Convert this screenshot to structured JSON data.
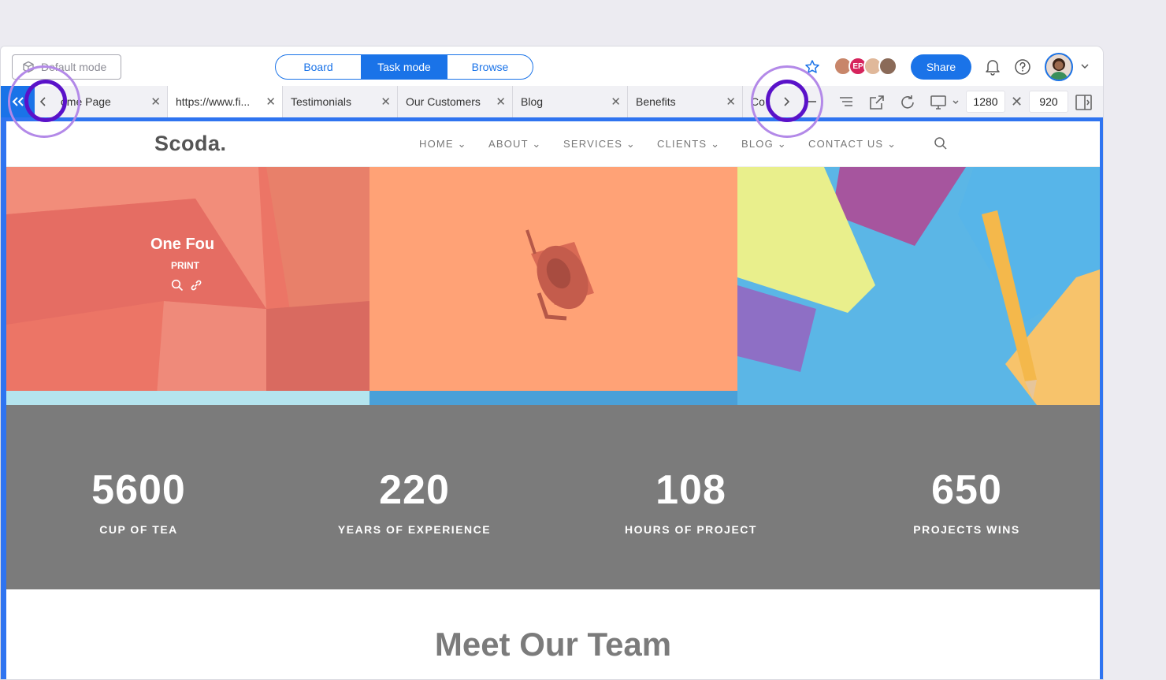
{
  "toolbar": {
    "mode_label": "Default mode",
    "segments": [
      "Board",
      "Task mode",
      "Browse"
    ],
    "active_segment": "Task mode",
    "avatar_initials": "EP",
    "share_label": "Share"
  },
  "tabs": [
    {
      "label": "ome Page"
    },
    {
      "label": "https://www.fi..."
    },
    {
      "label": "Testimonials"
    },
    {
      "label": "Our Customers"
    },
    {
      "label": "Blog"
    },
    {
      "label": "Benefits"
    },
    {
      "label": "Co"
    }
  ],
  "viewport": {
    "width": "1280",
    "height": "920"
  },
  "site": {
    "logo": "Scoda.",
    "nav": [
      "HOME",
      "ABOUT",
      "SERVICES",
      "CLIENTS",
      "BLOG",
      "CONTACT US"
    ],
    "portfolio_overlay": {
      "title": "One Fou",
      "category": "PRINT"
    },
    "stats": [
      {
        "number": "5600",
        "label": "CUP OF TEA"
      },
      {
        "number": "220",
        "label": "YEARS OF EXPERIENCE"
      },
      {
        "number": "108",
        "label": "HOURS OF PROJECT"
      },
      {
        "number": "650",
        "label": "PROJECTS WINS"
      }
    ],
    "team_heading": "Meet Our Team"
  },
  "colors": {
    "accent": "#1a73e8",
    "highlight_ring": "#5a12c9",
    "stats_bg": "#7b7b7b"
  }
}
